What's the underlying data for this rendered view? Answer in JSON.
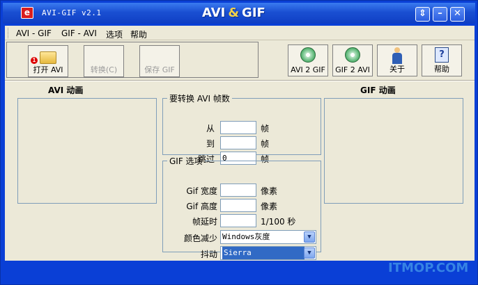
{
  "window": {
    "title": "AVI-GIF v2.1",
    "brand_left": "AVI",
    "brand_amp": "&",
    "brand_right": "GIF",
    "app_icon_glyph": "e",
    "controls": {
      "restore": "⇕",
      "minimize": "–",
      "close": "✕"
    }
  },
  "menu": [
    "AVI - GIF",
    "GIF - AVI",
    "选项",
    "帮助"
  ],
  "toolbar": {
    "open_avi": "打开 AVI",
    "convert": "转换(C)",
    "save_gif": "保存 GIF",
    "avi2gif": "AVI 2 GIF",
    "gif2avi": "GIF 2 AVI",
    "about": "关于",
    "help": "帮助",
    "badge": "1"
  },
  "panels": {
    "avi_title": "AVI  动画",
    "gif_title": "GIF  动画"
  },
  "frames": {
    "legend": "要转换 AVI 帧数",
    "from_label": "从",
    "to_label": "到",
    "skip_label": "跳过",
    "from_value": "",
    "to_value": "",
    "skip_value": "0",
    "unit": "帧"
  },
  "gif_options": {
    "legend": "GIF 选项",
    "width_label": "Gif 宽度",
    "height_label": "Gif 高度",
    "delay_label": "帧延时",
    "colors_label": "颜色减少",
    "dither_label": "抖动",
    "width_value": "",
    "height_value": "",
    "delay_value": "",
    "pixel_unit": "像素",
    "delay_unit": "1/100 秒",
    "colors_value": "Windows灰度",
    "dither_value": "Sierra"
  },
  "watermark": "ITMOP.COM",
  "colors": {
    "titlebar": "#1a4fd2",
    "face": "#ece9d8",
    "border": "#7f9db9",
    "selection": "#316ac5"
  }
}
